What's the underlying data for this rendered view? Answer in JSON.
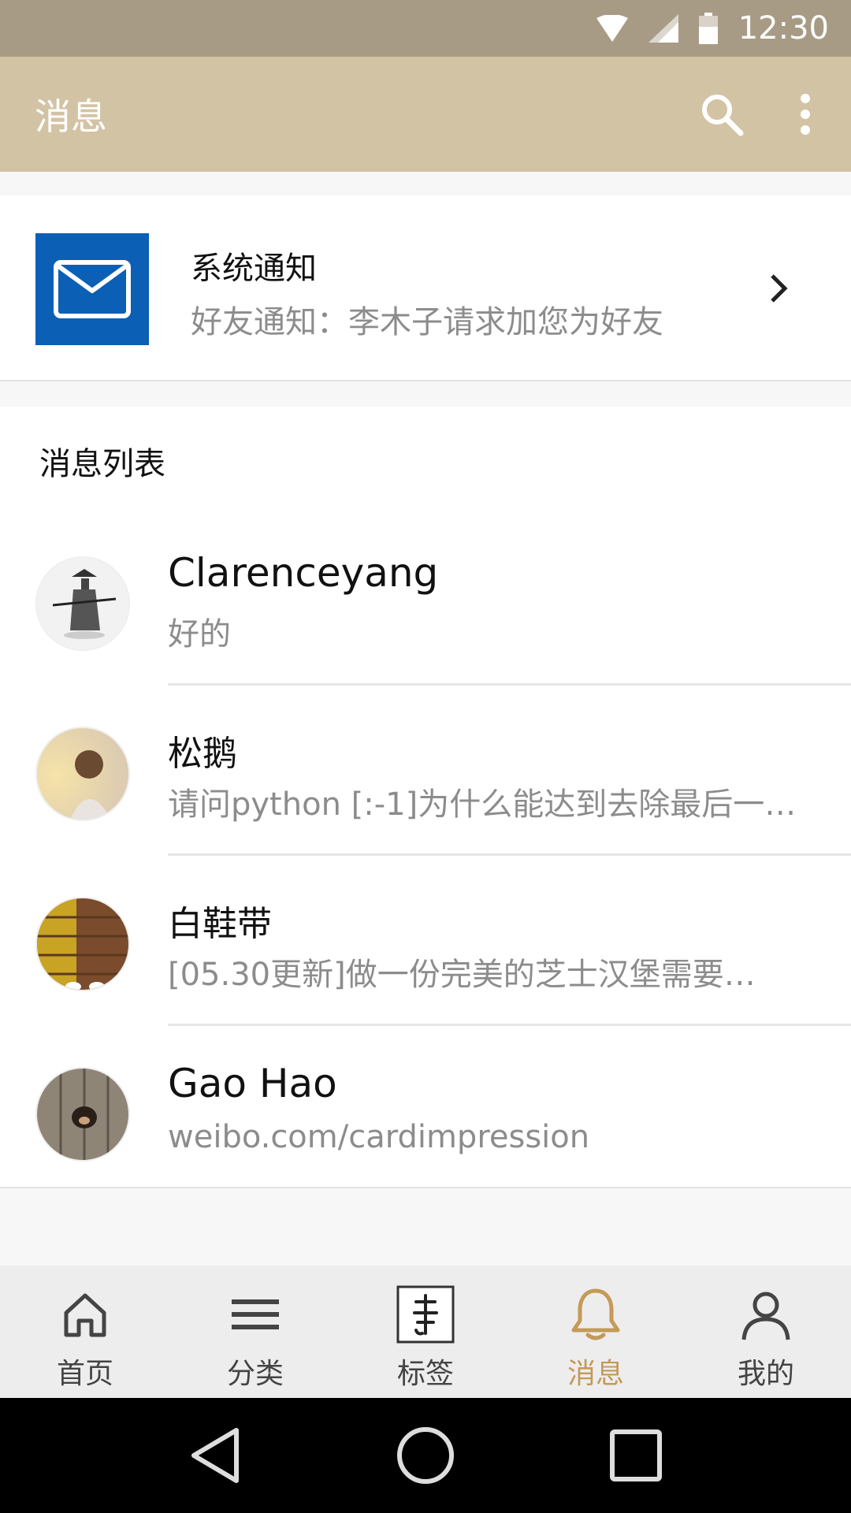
{
  "status_bar": {
    "time": "12:30",
    "icons": [
      "wifi-icon",
      "signal-icon",
      "battery-icon"
    ]
  },
  "app_bar": {
    "title": "消息",
    "actions": [
      "search-icon",
      "more-vert-icon"
    ]
  },
  "system_notice": {
    "icon": "mail-icon",
    "icon_color": "#0b5fb5",
    "title": "系统通知",
    "subtitle": "好友通知：李木子请求加您为好友"
  },
  "message_list": {
    "heading": "消息列表",
    "items": [
      {
        "name": "Clarenceyang",
        "snippet": "好的",
        "avatar": "avatar-swordsman"
      },
      {
        "name": "松鹅",
        "snippet": "请问python [:-1]为什么能达到去除最后一…",
        "avatar": "avatar-boy"
      },
      {
        "name": "白鞋带",
        "snippet": "[05.30更新]做一份完美的芝士汉堡需要…",
        "avatar": "avatar-shoes"
      },
      {
        "name": "Gao Hao",
        "snippet": "weibo.com/cardimpression",
        "avatar": "avatar-dog"
      }
    ]
  },
  "tab_bar": {
    "active_color": "#c49a57",
    "tabs": [
      {
        "label": "首页",
        "icon": "home-icon"
      },
      {
        "label": "分类",
        "icon": "menu-icon"
      },
      {
        "label": "标签",
        "icon": "tag-seal-icon"
      },
      {
        "label": "消息",
        "icon": "bell-icon",
        "active": true
      },
      {
        "label": "我的",
        "icon": "person-icon"
      }
    ]
  },
  "nav_bar": {
    "buttons": [
      "back-icon",
      "home-circle-icon",
      "recents-icon"
    ]
  }
}
